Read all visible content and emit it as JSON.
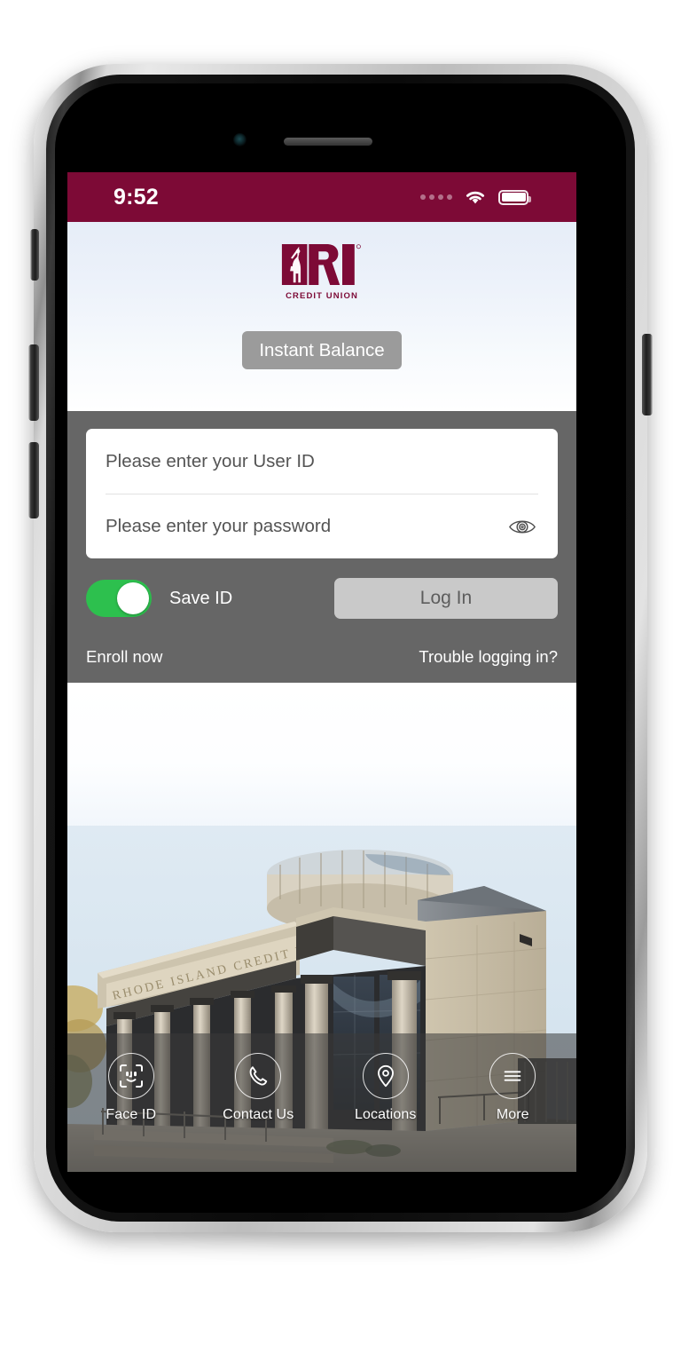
{
  "app": {
    "brand_name": "RI Credit Union",
    "brand_color": "#7d0a36",
    "panel_color": "#666666",
    "accent_green": "#2dc04e"
  },
  "status_bar": {
    "time": "9:52",
    "signal_icon": "signal-dots-icon",
    "wifi_icon": "wifi-icon",
    "battery_icon": "battery-full-icon"
  },
  "hero": {
    "logo_mark": "ri-logo-icon",
    "logo_subtitle": "CREDIT UNION",
    "instant_balance_label": "Instant Balance"
  },
  "login": {
    "user_id": {
      "value": "",
      "placeholder": "Please enter your User ID"
    },
    "password": {
      "value": "",
      "placeholder": "Please enter your password",
      "reveal_icon": "eye-icon"
    },
    "save_id_label": "Save ID",
    "save_id_state": "on",
    "log_in_label": "Log In",
    "log_in_enabled": "false",
    "enroll_label": "Enroll now",
    "trouble_label": "Trouble logging in?"
  },
  "photo": {
    "building_inscription": "RHODE ISLAND CREDIT UNION",
    "alt": "Rhode Island Credit Union headquarters building"
  },
  "tabbar": {
    "items": [
      {
        "label": "Face ID",
        "icon": "face-id-icon"
      },
      {
        "label": "Contact Us",
        "icon": "phone-icon"
      },
      {
        "label": "Locations",
        "icon": "map-pin-icon"
      },
      {
        "label": "More",
        "icon": "hamburger-menu-icon"
      }
    ]
  }
}
